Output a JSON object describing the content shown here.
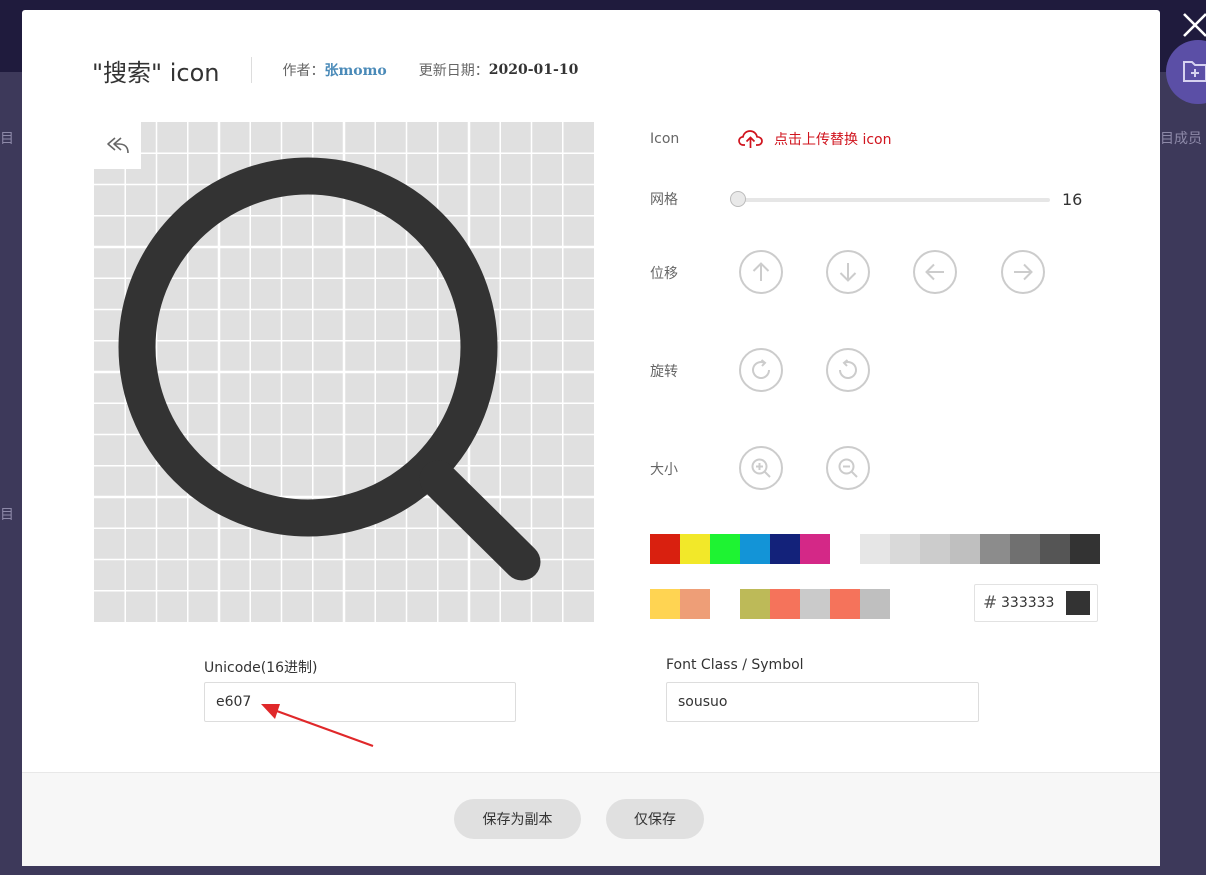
{
  "background": {
    "left_fragment_1": "目",
    "left_fragment_2": "目",
    "right_fragment": "项目成员"
  },
  "dialog": {
    "title": "\"搜索\" icon",
    "author_label": "作者：",
    "author_name": "张momo",
    "date_label": "更新日期：",
    "date_value": "2020-01-10"
  },
  "controls": {
    "icon_label": "Icon",
    "upload_text": "点击上传替换 icon",
    "grid_label": "网格",
    "grid_value": "16",
    "grid_level": 0,
    "move_label": "位移",
    "rotate_label": "旋转",
    "size_label": "大小"
  },
  "colors": {
    "row1": [
      "#d9200f",
      "#f2e829",
      "#1ef332",
      "#1394d7",
      "#13227a",
      "#d42887",
      "#ffffff",
      "#e6e6e6",
      "#d9d9d9",
      "#cccccc",
      "#bfbfbf",
      "#8c8c8c",
      "#707070",
      "#555555",
      "#333333"
    ],
    "row2": [
      "#ffd452",
      "#ee9e77",
      "#ffffff",
      "#bdba58",
      "#f5735b",
      "#cacaca",
      "#f5735b",
      "#bfbfbf"
    ],
    "hex_symbol": "#",
    "hex_value": "333333",
    "current": "#333333",
    "icon_color": "#333333",
    "grid_background": "#e0e0e0",
    "accent_upload": "#d0141e",
    "author_color": "#4a8ab8"
  },
  "fields": {
    "unicode_label": "Unicode(16进制)",
    "unicode_value": "e607",
    "fontclass_label": "Font Class / Symbol",
    "fontclass_value": "sousuo"
  },
  "buttons": {
    "save_copy": "保存为副本",
    "save_only": "仅保存"
  }
}
